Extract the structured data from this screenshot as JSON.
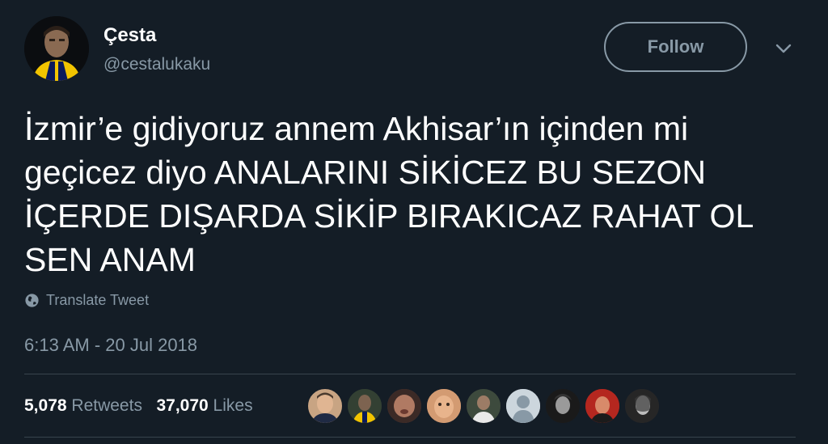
{
  "user": {
    "display_name": "Çesta",
    "handle": "@cestalukaku"
  },
  "follow_label": "Follow",
  "tweet": {
    "text": "İzmir’e gidiyoruz annem Akhisar’ın içinden mi geçicez diyo ANALARINI SİKİCEZ BU SEZON İÇERDE DIŞARDA SİKİP BIRAKICAZ RAHAT OL SEN ANAM",
    "translate_label": "Translate Tweet",
    "timestamp": "6:13 AM - 20 Jul 2018"
  },
  "stats": {
    "retweets_count": "5,078",
    "retweets_label": "Retweets",
    "likes_count": "37,070",
    "likes_label": "Likes"
  },
  "colors": {
    "background": "#141d26",
    "secondary_text": "#8899a6",
    "divider": "#38444d"
  },
  "icons": [
    "globe-icon",
    "chevron-down-icon"
  ]
}
